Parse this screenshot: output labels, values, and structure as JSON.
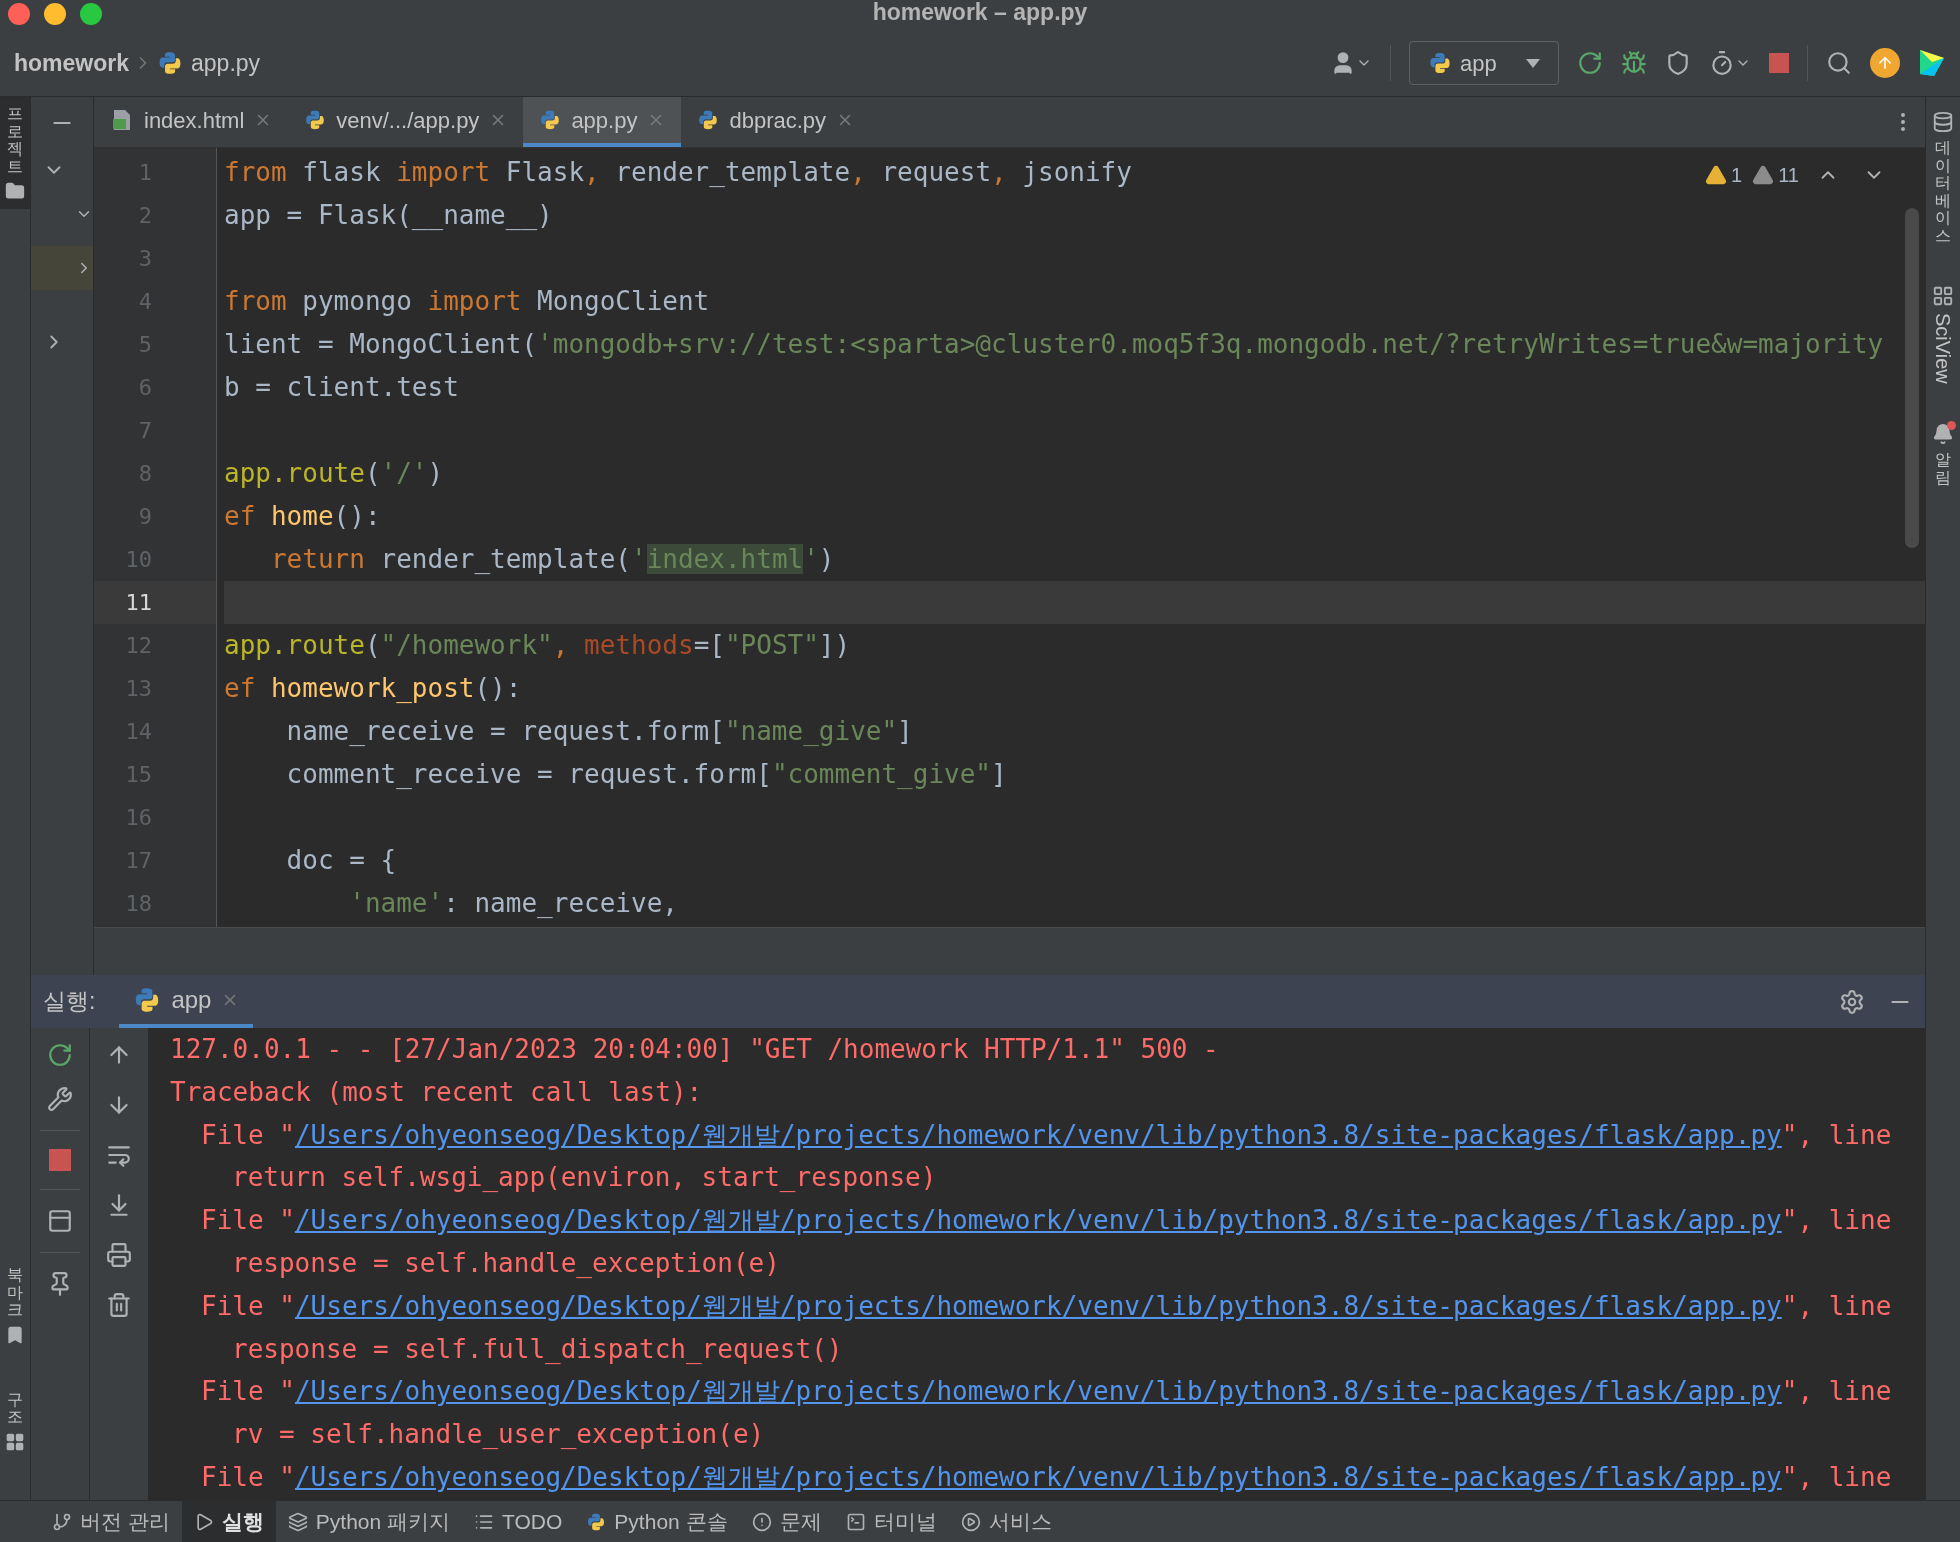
{
  "window": {
    "title": "homework – app.py"
  },
  "breadcrumb": {
    "project": "homework",
    "file": "app.py"
  },
  "toolbar": {
    "run_config": "app"
  },
  "left_stripe": [
    {
      "label": "프로젝트",
      "kind": "project",
      "selected": true
    },
    {
      "label": "북마크",
      "kind": "bookmarks",
      "selected": false
    },
    {
      "label": "구조",
      "kind": "structure",
      "selected": false
    }
  ],
  "right_stripe": [
    {
      "label": "데이터베이스",
      "kind": "database"
    },
    {
      "label": "SciView",
      "kind": "sciview"
    },
    {
      "label": "알림",
      "kind": "notifications"
    }
  ],
  "tabs": [
    {
      "label": "index.html",
      "kind": "html",
      "selected": false
    },
    {
      "label": "venv/.../app.py",
      "kind": "python",
      "selected": false
    },
    {
      "label": "app.py",
      "kind": "python",
      "selected": true
    },
    {
      "label": "dbprac.py",
      "kind": "python",
      "selected": false
    }
  ],
  "editor": {
    "warnings": [
      {
        "count": "1",
        "kind": "warning"
      },
      {
        "count": "11",
        "kind": "weak"
      }
    ],
    "lines": [
      {
        "number": "1",
        "selected": false,
        "tokens": [
          {
            "kind": "kw",
            "t": "from"
          },
          {
            "kind": "plain",
            "t": " flask "
          },
          {
            "kind": "kw",
            "t": "import"
          },
          {
            "kind": "plain",
            "t": " Flask"
          },
          {
            "kind": "kw",
            "t": ","
          },
          {
            "kind": "plain",
            "t": " render_template"
          },
          {
            "kind": "kw",
            "t": ","
          },
          {
            "kind": "plain",
            "t": " request"
          },
          {
            "kind": "kw",
            "t": ","
          },
          {
            "kind": "plain",
            "t": " jsonify"
          }
        ]
      },
      {
        "number": "2",
        "selected": false,
        "tokens": [
          {
            "kind": "plain",
            "t": "app = Flask(__name__)"
          }
        ]
      },
      {
        "number": "3",
        "selected": false
      },
      {
        "number": "4",
        "selected": false,
        "tokens": [
          {
            "kind": "kw",
            "t": "from"
          },
          {
            "kind": "plain",
            "t": " pymongo "
          },
          {
            "kind": "kw",
            "t": "import"
          },
          {
            "kind": "plain",
            "t": " MongoClient"
          }
        ]
      },
      {
        "number": "5",
        "selected": false,
        "tokens": [
          {
            "kind": "plain",
            "t": "lient = MongoClient("
          },
          {
            "kind": "str",
            "t": "'mongodb+srv://test:<sparta>@cluster0.moq5f3q.mongodb.net/?retryWrites=true&w=majority"
          }
        ]
      },
      {
        "number": "6",
        "selected": false,
        "tokens": [
          {
            "kind": "plain",
            "t": "b = client.test"
          }
        ]
      },
      {
        "number": "7",
        "selected": false
      },
      {
        "number": "8",
        "selected": false,
        "tokens": [
          {
            "kind": "deco",
            "t": "app.route"
          },
          {
            "kind": "plain",
            "t": "("
          },
          {
            "kind": "str",
            "t": "'/'"
          },
          {
            "kind": "plain",
            "t": ")"
          }
        ]
      },
      {
        "number": "9",
        "selected": false,
        "tokens": [
          {
            "kind": "kw",
            "t": "ef"
          },
          {
            "kind": "func",
            "t": " home"
          },
          {
            "kind": "plain",
            "t": "():"
          }
        ]
      },
      {
        "number": "10",
        "selected": false,
        "tokens": [
          {
            "kind": "kw",
            "t": "   return"
          },
          {
            "kind": "plain",
            "t": " render_template("
          },
          {
            "kind": "str",
            "t": "'"
          },
          {
            "kind": "strhl",
            "t": "index.html"
          },
          {
            "kind": "str",
            "t": "'"
          },
          {
            "kind": "plain",
            "t": ")"
          }
        ]
      },
      {
        "number": "11",
        "selected": true
      },
      {
        "number": "12",
        "selected": false,
        "tokens": [
          {
            "kind": "deco",
            "t": "app.route"
          },
          {
            "kind": "plain",
            "t": "("
          },
          {
            "kind": "str",
            "t": "\"/homework\""
          },
          {
            "kind": "kw",
            "t": ","
          },
          {
            "kind": "param",
            "t": " methods"
          },
          {
            "kind": "plain",
            "t": "=["
          },
          {
            "kind": "str",
            "t": "\"POST\""
          },
          {
            "kind": "plain",
            "t": "])"
          }
        ]
      },
      {
        "number": "13",
        "selected": false,
        "tokens": [
          {
            "kind": "kw",
            "t": "ef"
          },
          {
            "kind": "func",
            "t": " homework_post"
          },
          {
            "kind": "plain",
            "t": "():"
          }
        ]
      },
      {
        "number": "14",
        "selected": false,
        "tokens": [
          {
            "kind": "plain",
            "t": "    name_receive = request.form["
          },
          {
            "kind": "str",
            "t": "\"name_give\""
          },
          {
            "kind": "plain",
            "t": "]"
          }
        ]
      },
      {
        "number": "15",
        "selected": false,
        "tokens": [
          {
            "kind": "plain",
            "t": "    comment_receive = request.form["
          },
          {
            "kind": "str",
            "t": "\"comment_give\""
          },
          {
            "kind": "plain",
            "t": "]"
          }
        ]
      },
      {
        "number": "16",
        "selected": false
      },
      {
        "number": "17",
        "selected": false,
        "tokens": [
          {
            "kind": "plain",
            "t": "    doc = {"
          }
        ]
      },
      {
        "number": "18",
        "selected": false,
        "tokens": [
          {
            "kind": "str",
            "t": "        'name'"
          },
          {
            "kind": "plain",
            "t": ": name_receive,"
          }
        ]
      }
    ]
  },
  "run_panel": {
    "label": "실행:",
    "tabs": [
      {
        "label": "app",
        "selected": true
      }
    ],
    "output": [
      {
        "kind": "plain",
        "text": "127.0.0.1 - - [27/Jan/2023 20:04:00] \"GET /homework HTTP/1.1\" 500 -"
      },
      {
        "kind": "plain",
        "text": "Traceback (most recent call last):"
      },
      {
        "kind": "file",
        "prefix": "File \"",
        "link": "/Users/ohyeonseog/Desktop/웹개발/projects/homework/venv/lib/python3.8/site-packages/flask/app.py",
        "suffix": "\", line"
      },
      {
        "kind": "code",
        "text": "return self.wsgi_app(environ, start_response)"
      },
      {
        "kind": "file",
        "prefix": "File \"",
        "link": "/Users/ohyeonseog/Desktop/웹개발/projects/homework/venv/lib/python3.8/site-packages/flask/app.py",
        "suffix": "\", line"
      },
      {
        "kind": "code",
        "text": "response = self.handle_exception(e)"
      },
      {
        "kind": "file",
        "prefix": "File \"",
        "link": "/Users/ohyeonseog/Desktop/웹개발/projects/homework/venv/lib/python3.8/site-packages/flask/app.py",
        "suffix": "\", line"
      },
      {
        "kind": "code",
        "text": "response = self.full_dispatch_request()"
      },
      {
        "kind": "file",
        "prefix": "File \"",
        "link": "/Users/ohyeonseog/Desktop/웹개발/projects/homework/venv/lib/python3.8/site-packages/flask/app.py",
        "suffix": "\", line"
      },
      {
        "kind": "code",
        "text": "rv = self.handle_user_exception(e)"
      },
      {
        "kind": "file",
        "prefix": "File \"",
        "link": "/Users/ohyeonseog/Desktop/웹개발/projects/homework/venv/lib/python3.8/site-packages/flask/app.py",
        "suffix": "\", line"
      }
    ]
  },
  "status_bar": [
    {
      "label": "버전 관리",
      "kind": "vcs",
      "selected": false
    },
    {
      "label": "실행",
      "kind": "run",
      "selected": true
    },
    {
      "label": "Python 패키지",
      "kind": "packages",
      "selected": false
    },
    {
      "label": "TODO",
      "kind": "todo",
      "selected": false
    },
    {
      "label": "Python 콘솔",
      "kind": "console",
      "selected": false
    },
    {
      "label": "문제",
      "kind": "problems",
      "selected": false
    },
    {
      "label": "터미널",
      "kind": "terminal",
      "selected": false
    },
    {
      "label": "서비스",
      "kind": "services",
      "selected": false
    }
  ]
}
